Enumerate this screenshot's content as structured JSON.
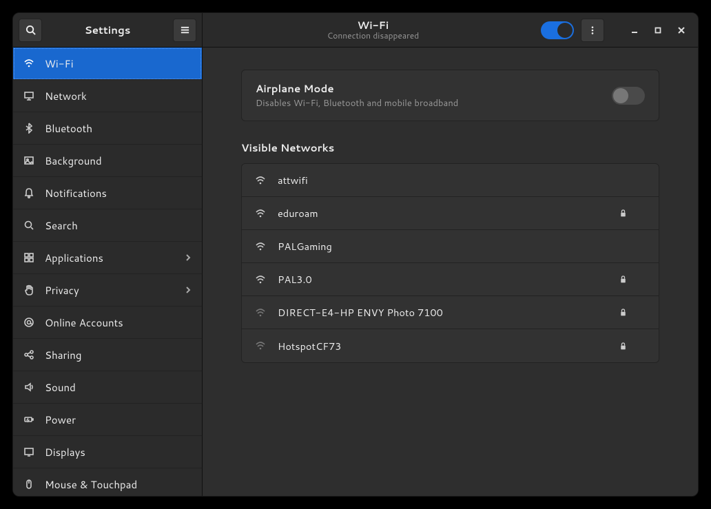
{
  "app_title": "Settings",
  "header": {
    "title": "Wi-Fi",
    "subtitle": "Connection disappeared",
    "wifi_enabled": true
  },
  "sidebar": {
    "items": [
      {
        "id": "wifi",
        "label": "Wi-Fi",
        "icon": "wifi-icon",
        "selected": true,
        "has_sub": false
      },
      {
        "id": "network",
        "label": "Network",
        "icon": "network-icon",
        "selected": false,
        "has_sub": false
      },
      {
        "id": "bluetooth",
        "label": "Bluetooth",
        "icon": "bluetooth-icon",
        "selected": false,
        "has_sub": false
      },
      {
        "id": "background",
        "label": "Background",
        "icon": "background-icon",
        "selected": false,
        "has_sub": false
      },
      {
        "id": "notifications",
        "label": "Notifications",
        "icon": "bell-icon",
        "selected": false,
        "has_sub": false
      },
      {
        "id": "search",
        "label": "Search",
        "icon": "search-icon",
        "selected": false,
        "has_sub": false
      },
      {
        "id": "applications",
        "label": "Applications",
        "icon": "apps-icon",
        "selected": false,
        "has_sub": true
      },
      {
        "id": "privacy",
        "label": "Privacy",
        "icon": "hand-icon",
        "selected": false,
        "has_sub": true
      },
      {
        "id": "online-accounts",
        "label": "Online Accounts",
        "icon": "at-icon",
        "selected": false,
        "has_sub": false
      },
      {
        "id": "sharing",
        "label": "Sharing",
        "icon": "share-icon",
        "selected": false,
        "has_sub": false
      },
      {
        "id": "sound",
        "label": "Sound",
        "icon": "speaker-icon",
        "selected": false,
        "has_sub": false
      },
      {
        "id": "power",
        "label": "Power",
        "icon": "battery-icon",
        "selected": false,
        "has_sub": false
      },
      {
        "id": "displays",
        "label": "Displays",
        "icon": "display-icon",
        "selected": false,
        "has_sub": false
      },
      {
        "id": "mouse",
        "label": "Mouse & Touchpad",
        "icon": "mouse-icon",
        "selected": false,
        "has_sub": false
      }
    ]
  },
  "airplane": {
    "title": "Airplane Mode",
    "description": "Disables Wi-Fi, Bluetooth and mobile broadband",
    "enabled": false
  },
  "networks": {
    "section_title": "Visible Networks",
    "list": [
      {
        "ssid": "attwifi",
        "signal": "strong",
        "secured": false
      },
      {
        "ssid": "eduroam",
        "signal": "strong",
        "secured": true
      },
      {
        "ssid": "PALGaming",
        "signal": "strong",
        "secured": false
      },
      {
        "ssid": "PAL3.0",
        "signal": "strong",
        "secured": true
      },
      {
        "ssid": "DIRECT-E4-HP ENVY Photo 7100",
        "signal": "weak",
        "secured": true
      },
      {
        "ssid": "HotspotCF73",
        "signal": "weak",
        "secured": true
      }
    ]
  },
  "icons": {
    "wifi-icon": "wifi",
    "network-icon": "net",
    "bluetooth-icon": "bt",
    "background-icon": "bg",
    "bell-icon": "bell",
    "search-icon": "search",
    "apps-icon": "apps",
    "hand-icon": "hand",
    "at-icon": "at",
    "share-icon": "share",
    "speaker-icon": "speaker",
    "battery-icon": "batt",
    "display-icon": "disp",
    "mouse-icon": "mouse"
  }
}
